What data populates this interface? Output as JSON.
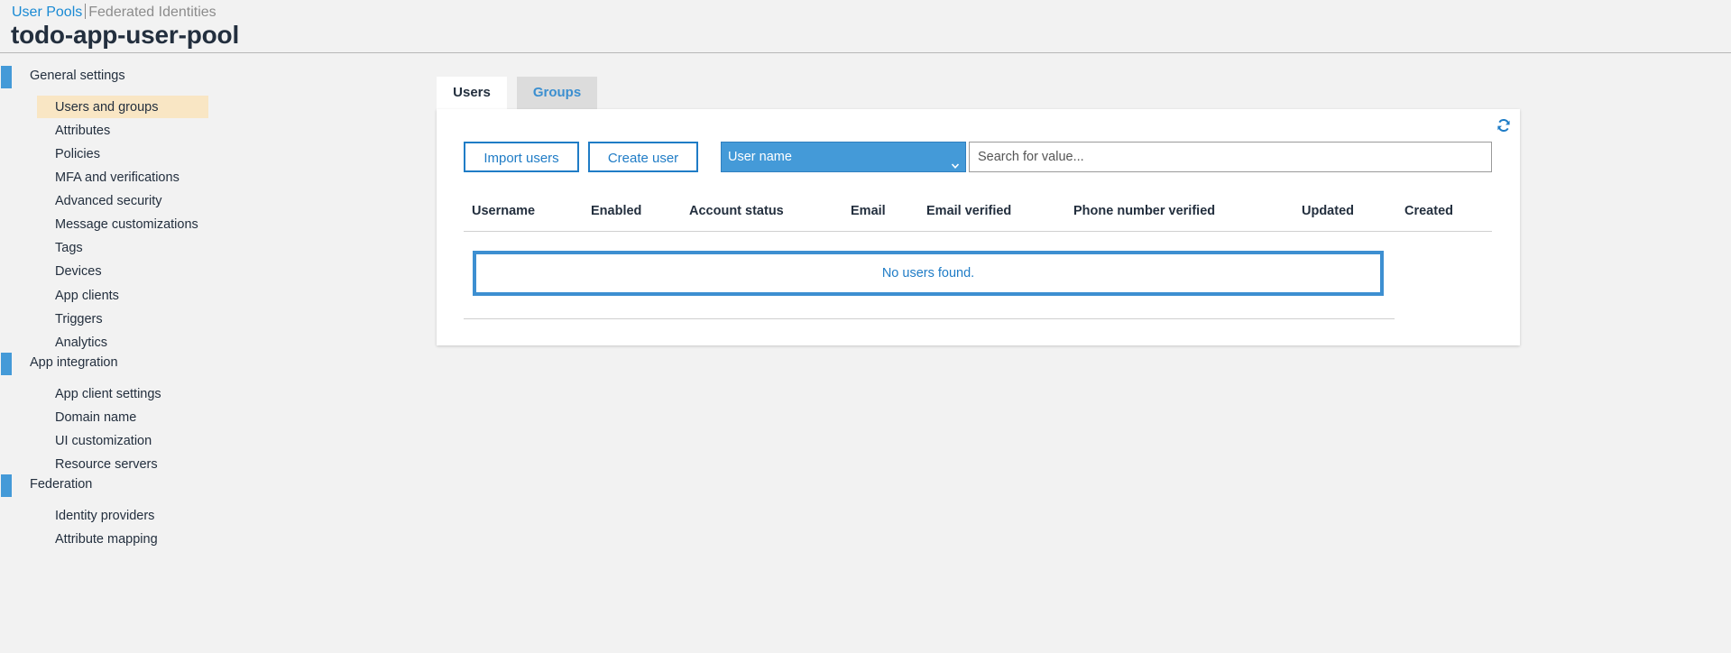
{
  "breadcrumb": {
    "user_pools": "User Pools",
    "federated_identities": "Federated Identities"
  },
  "pool_name": "todo-app-user-pool",
  "sidebar": {
    "sections": [
      {
        "label": "General settings",
        "items": [
          {
            "label": "Users and groups",
            "selected": true
          },
          {
            "label": "Attributes"
          },
          {
            "label": "Policies"
          },
          {
            "label": "MFA and verifications"
          },
          {
            "label": "Advanced security"
          },
          {
            "label": "Message customizations"
          },
          {
            "label": "Tags"
          },
          {
            "label": "Devices"
          },
          {
            "label": "App clients"
          },
          {
            "label": "Triggers"
          },
          {
            "label": "Analytics"
          }
        ]
      },
      {
        "label": "App integration",
        "items": [
          {
            "label": "App client settings"
          },
          {
            "label": "Domain name"
          },
          {
            "label": "UI customization"
          },
          {
            "label": "Resource servers"
          }
        ]
      },
      {
        "label": "Federation",
        "items": [
          {
            "label": "Identity providers"
          },
          {
            "label": "Attribute mapping"
          }
        ]
      }
    ]
  },
  "tabs": {
    "users": "Users",
    "groups": "Groups",
    "active": "users"
  },
  "toolbar": {
    "import_label": "Import users",
    "create_label": "Create user",
    "filter_selected": "User name",
    "search_placeholder": "Search for value...",
    "search_value": ""
  },
  "table": {
    "columns": [
      "Username",
      "Enabled",
      "Account status",
      "Email",
      "Email verified",
      "Phone number verified",
      "Updated",
      "Created"
    ],
    "empty_message": "No users found."
  },
  "colors": {
    "accent": "#1f7cc6",
    "section_marker": "#449ad8",
    "selected_nav": "#f9e6c4"
  },
  "icons": {
    "refresh": "refresh-icon",
    "dropdown": "chevron-down-icon"
  }
}
